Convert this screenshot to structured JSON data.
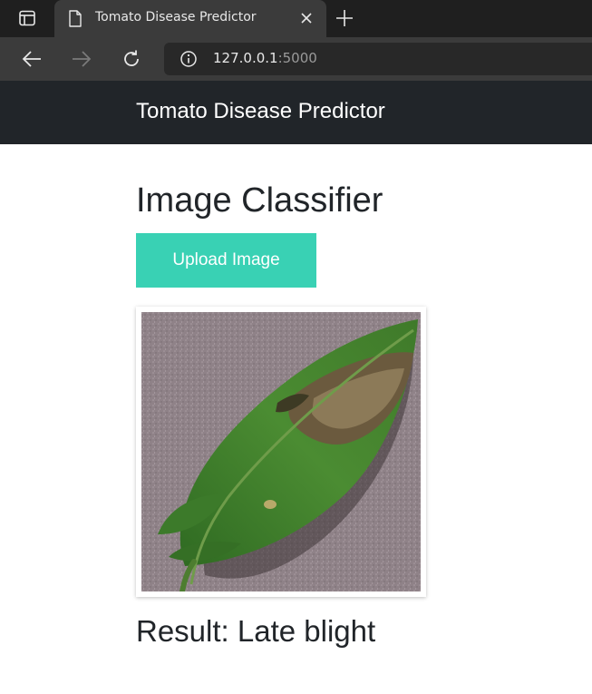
{
  "browser": {
    "tab": {
      "title": "Tomato Disease Predictor"
    },
    "address": {
      "host": "127.0.0.1",
      "port": ":5000"
    }
  },
  "navbar": {
    "brand": "Tomato Disease Predictor"
  },
  "main": {
    "heading": "Image Classifier",
    "upload_label": "Upload Image",
    "result_prefix": "Result:",
    "result_value": "Late blight"
  },
  "colors": {
    "navbar_bg": "#212529",
    "upload_button": "#39d1b4"
  }
}
